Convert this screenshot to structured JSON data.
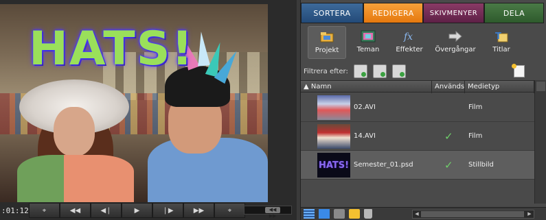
{
  "monitor": {
    "overlay_title": "HATS!",
    "timecode": ":01:12",
    "transport": [
      {
        "name": "marker-icon",
        "glyph": "⌖"
      },
      {
        "name": "rewind-icon",
        "glyph": "◀◀"
      },
      {
        "name": "step-back-icon",
        "glyph": "◀❘"
      },
      {
        "name": "play-icon",
        "glyph": "▶"
      },
      {
        "name": "step-forward-icon",
        "glyph": "❘▶"
      },
      {
        "name": "fast-forward-icon",
        "glyph": "▶▶"
      },
      {
        "name": "marker-2-icon",
        "glyph": "⌖"
      }
    ],
    "jog_label": "◀◀ ▶▶"
  },
  "tabs": [
    {
      "label": "SORTERA"
    },
    {
      "label": "REDIGERA"
    },
    {
      "label": "SKIVMENYER"
    },
    {
      "label": "DELA"
    }
  ],
  "toolbar": [
    {
      "label": "Projekt",
      "icon": "project-icon",
      "active": true
    },
    {
      "label": "Teman",
      "icon": "themes-icon"
    },
    {
      "label": "Effekter",
      "icon": "effects-icon"
    },
    {
      "label": "Övergångar",
      "icon": "transitions-icon"
    },
    {
      "label": "Titlar",
      "icon": "titles-icon"
    }
  ],
  "filter": {
    "label": "Filtrera efter:"
  },
  "table": {
    "columns": [
      "Namn",
      "Används",
      "Medietyp"
    ],
    "rows": [
      {
        "name": "02.AVI",
        "used": "",
        "type": "Film"
      },
      {
        "name": "14.AVI",
        "used": "✓",
        "type": "Film"
      },
      {
        "name": "Semester_01.psd",
        "used": "✓",
        "type": "Stillbild",
        "thumb_text": "HATS!"
      }
    ]
  },
  "colors": {
    "tab_sortera": "#2d5a8a",
    "tab_redigera": "#f08a1e",
    "tab_skivmenyer": "#742f58",
    "tab_dela": "#3c6a38",
    "check": "#6fd06a"
  }
}
